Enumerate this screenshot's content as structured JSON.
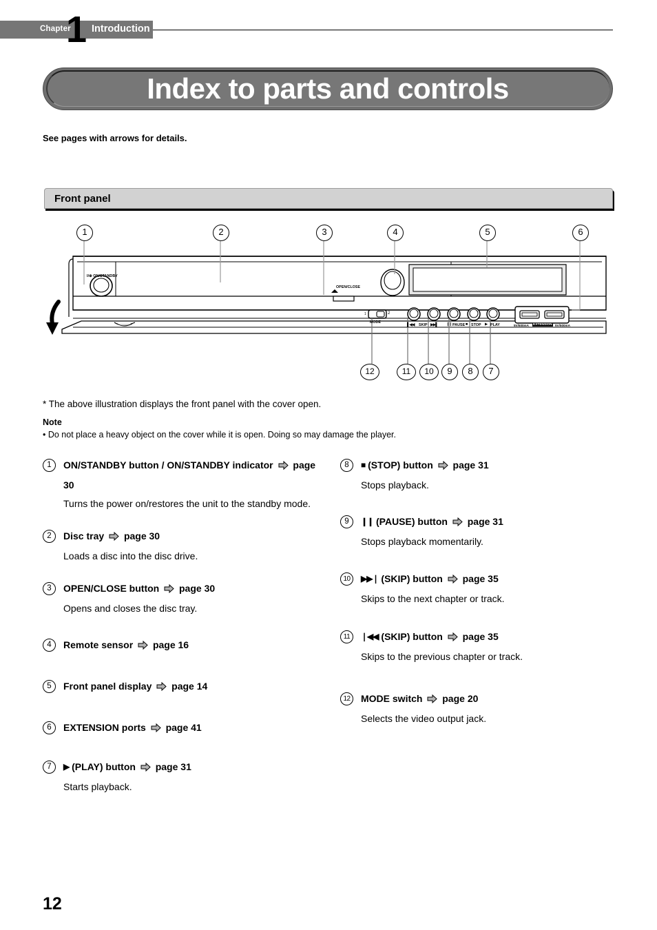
{
  "header": {
    "chapter_word": "Chapter",
    "chapter_number": "1",
    "chapter_title": "Introduction"
  },
  "title": "Index to parts and controls",
  "intro_line": "See pages with arrows for details.",
  "section": {
    "label": "Front panel"
  },
  "illustration": {
    "top_callouts": [
      "1",
      "2",
      "3",
      "4",
      "5",
      "6"
    ],
    "bottom_callouts": [
      "12",
      "11",
      "10",
      "9",
      "8",
      "7"
    ],
    "panel_labels": {
      "power": "I/⊕ ON/STANDBY",
      "open_close": "OPEN/CLOSE",
      "mode": "MODE",
      "mode_pos_1": "1",
      "mode_pos_2": "2",
      "skip": "SKIP",
      "pause": "PAUSE",
      "stop": "STOP",
      "play": "PLAY",
      "extension": "EXTENSION",
      "usb_rating_left": "5V/500mA",
      "usb_rating_right": "5V/500mA"
    }
  },
  "footnote": "* The above illustration displays the front panel with the cover open.",
  "note": {
    "heading": "Note",
    "body": "• Do not place a heavy object on the cover while it is open. Doing so may damage the player."
  },
  "legend": {
    "left": [
      {
        "num": "1",
        "title": "ON/STANDBY button / ON/STANDBY indicator",
        "page": "page 30",
        "desc": "Turns the power on/restores the unit to the standby mode."
      },
      {
        "num": "2",
        "title": "Disc tray",
        "page": "page 30",
        "desc": "Loads a disc into the disc drive."
      },
      {
        "num": "3",
        "title": "OPEN/CLOSE button",
        "page": "page 30",
        "desc": "Opens and closes the disc tray."
      },
      {
        "num": "4",
        "title": "Remote sensor",
        "page": "page 16",
        "desc": ""
      },
      {
        "num": "5",
        "title": "Front panel display",
        "page": "page 14",
        "desc": ""
      },
      {
        "num": "6",
        "title": "EXTENSION ports",
        "page": "page 41",
        "desc": ""
      },
      {
        "num": "7",
        "glyph": "▶",
        "title": "(PLAY) button",
        "page": "page 31",
        "desc": "Starts playback."
      }
    ],
    "right": [
      {
        "num": "8",
        "glyph": "■",
        "title": "(STOP) button",
        "page": "page 31",
        "desc": "Stops playback."
      },
      {
        "num": "9",
        "glyph": "❙❙",
        "title": "(PAUSE) button",
        "page": "page 31",
        "desc": "Stops playback momentarily."
      },
      {
        "num": "10",
        "glyph": "▶▶❘",
        "title": "(SKIP) button",
        "page": "page 35",
        "desc": "Skips to the next chapter or track."
      },
      {
        "num": "11",
        "glyph": "❘◀◀",
        "title": "(SKIP) button",
        "page": "page 35",
        "desc": "Skips to the previous chapter or track."
      },
      {
        "num": "12",
        "title": "MODE switch",
        "page": "page 20",
        "desc": "Selects the video output jack."
      }
    ]
  },
  "page_number": "12",
  "colors": {
    "header_band": "#767676",
    "title_pill": "#777777",
    "section_bar": "#d2d2d2",
    "arrow_icon": "#b0b0b0"
  }
}
